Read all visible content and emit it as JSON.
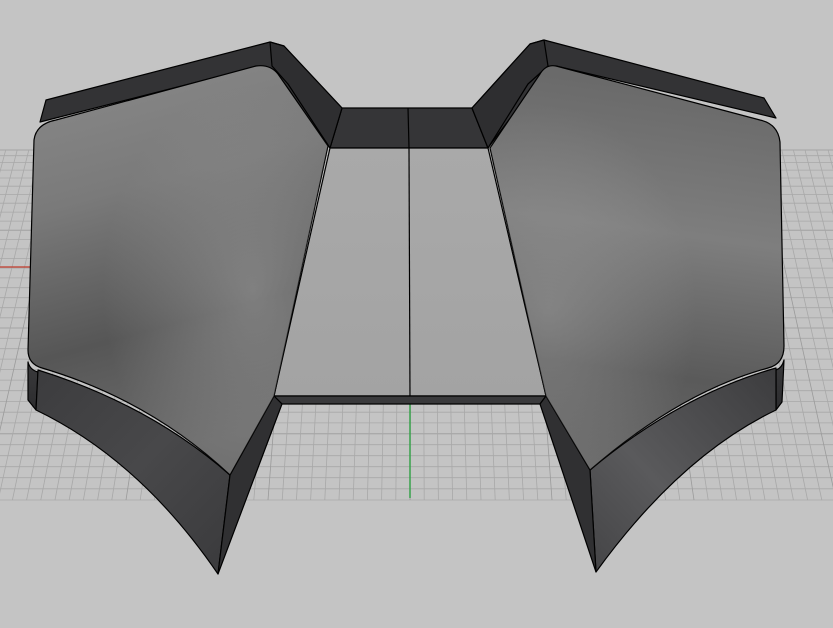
{
  "viewport": {
    "background_color": "#c4c4c4",
    "grid_line_color": "#a8a8a8",
    "grid_major_color": "#9a9a9a",
    "x_axis_color": "#c0392b",
    "y_axis_color": "#2ea043"
  },
  "model": {
    "edge_color": "#000000",
    "dark_face_color": "#333335",
    "top_face_light": "#8c8c8c",
    "top_face_dark": "#5a5a5a",
    "center_panel_color": "#a8a8a8"
  }
}
